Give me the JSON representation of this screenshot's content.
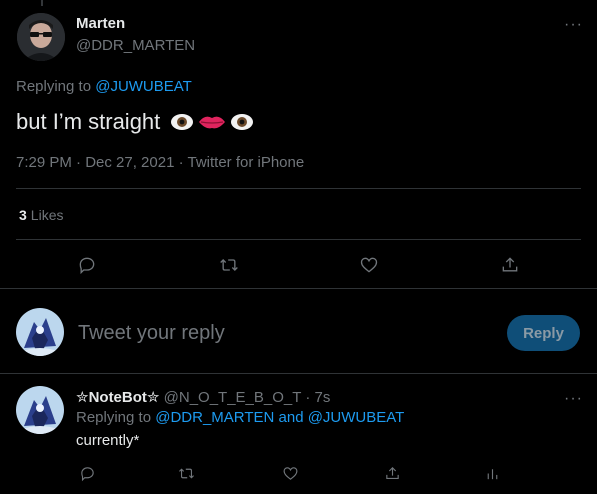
{
  "tweet": {
    "author_name": "Marten",
    "author_handle": "@DDR_MARTEN",
    "replying_prefix": "Replying to",
    "replying_to": "@JUWUBEAT",
    "text": "but I’m straight",
    "emoji": [
      "eye-emoji",
      "lips-emoji",
      "eye-emoji"
    ],
    "timestamp": "7:29 PM · Dec 27, 2021 · Twitter for iPhone",
    "likes_count": "3",
    "likes_label": "Likes",
    "more_label": "···"
  },
  "composer": {
    "placeholder": "Tweet your reply",
    "reply_button": "Reply"
  },
  "reply": {
    "author_name": "✮NoteBot✮",
    "author_handle": "@N_O_T_E_B_O_T · 7s",
    "replying_prefix": "Replying to",
    "replying_to": "@DDR_MARTEN and @JUWUBEAT",
    "text": "currently*",
    "more_label": "···"
  },
  "colors": {
    "background": "#000000",
    "text": "#e7e9ea",
    "secondary": "#71767b",
    "link": "#1d9bf0",
    "reply_button_bg": "#0f4e78",
    "divider": "#2f3336"
  }
}
